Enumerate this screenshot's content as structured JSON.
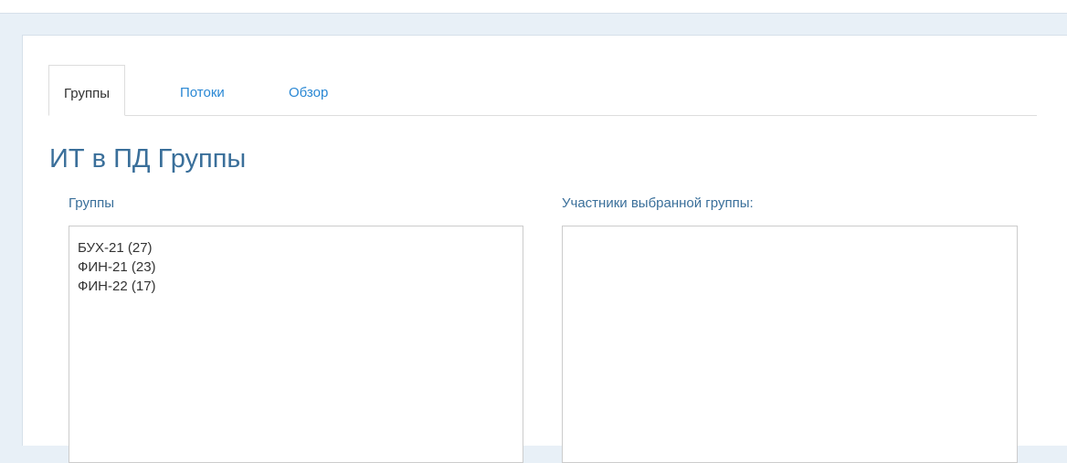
{
  "tabs": [
    {
      "label": "Группы",
      "active": true
    },
    {
      "label": "Потоки",
      "active": false
    },
    {
      "label": "Обзор",
      "active": false
    }
  ],
  "page": {
    "title": "ИТ в ПД Группы"
  },
  "groups": {
    "label": "Группы",
    "items": [
      "БУХ-21 (27)",
      "ФИН-21 (23)",
      "ФИН-22 (17)"
    ]
  },
  "members": {
    "label": "Участники выбранной группы:",
    "items": []
  },
  "colors": {
    "background": "#e8f0f7",
    "accent_link": "#2a88d4",
    "heading": "#3a6f9a",
    "text": "#333333"
  }
}
